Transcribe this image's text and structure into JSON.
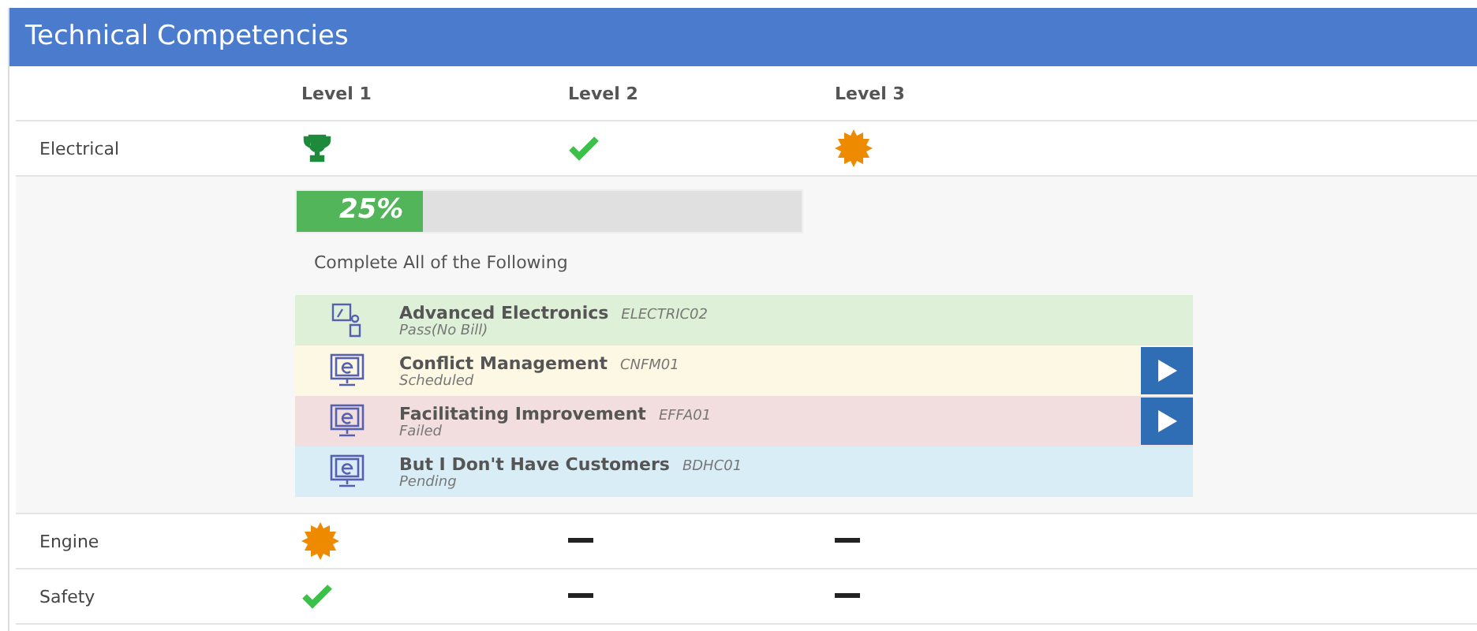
{
  "panel": {
    "title": "Technical Competencies"
  },
  "columns": [
    "Level 1",
    "Level 2",
    "Level 3"
  ],
  "rows": [
    {
      "name": "Electrical",
      "levels": [
        {
          "kind": "trophy"
        },
        {
          "kind": "check"
        },
        {
          "kind": "badge"
        }
      ],
      "detail": {
        "progress": {
          "level": 0.25,
          "reading": "25%"
        },
        "instruction": "Complete All of the Following",
        "courses": [
          {
            "kind": "classroom",
            "title": "Advanced Electronics",
            "code": "ELECTRIC02",
            "status": "Pass(No Bill)",
            "color": "#dff0d8",
            "launch": false
          },
          {
            "kind": "elearning",
            "title": "Conflict Management",
            "code": "CNFM01",
            "status": "Scheduled",
            "color": "#fcf8e3",
            "launch": true
          },
          {
            "kind": "elearning",
            "title": "Facilitating Improvement",
            "code": "EFFA01",
            "status": "Failed",
            "color": "#f2dede",
            "launch": true
          },
          {
            "kind": "elearning",
            "title": "But I Don't Have Customers",
            "code": "BDHC01",
            "status": "Pending",
            "color": "#d9edf7",
            "launch": false
          }
        ]
      }
    },
    {
      "name": "Engine",
      "levels": [
        {
          "kind": "badge"
        },
        {
          "kind": "none"
        },
        {
          "kind": "none"
        }
      ]
    },
    {
      "name": "Safety",
      "levels": [
        {
          "kind": "check"
        },
        {
          "kind": "none"
        },
        {
          "kind": "none"
        }
      ]
    }
  ]
}
